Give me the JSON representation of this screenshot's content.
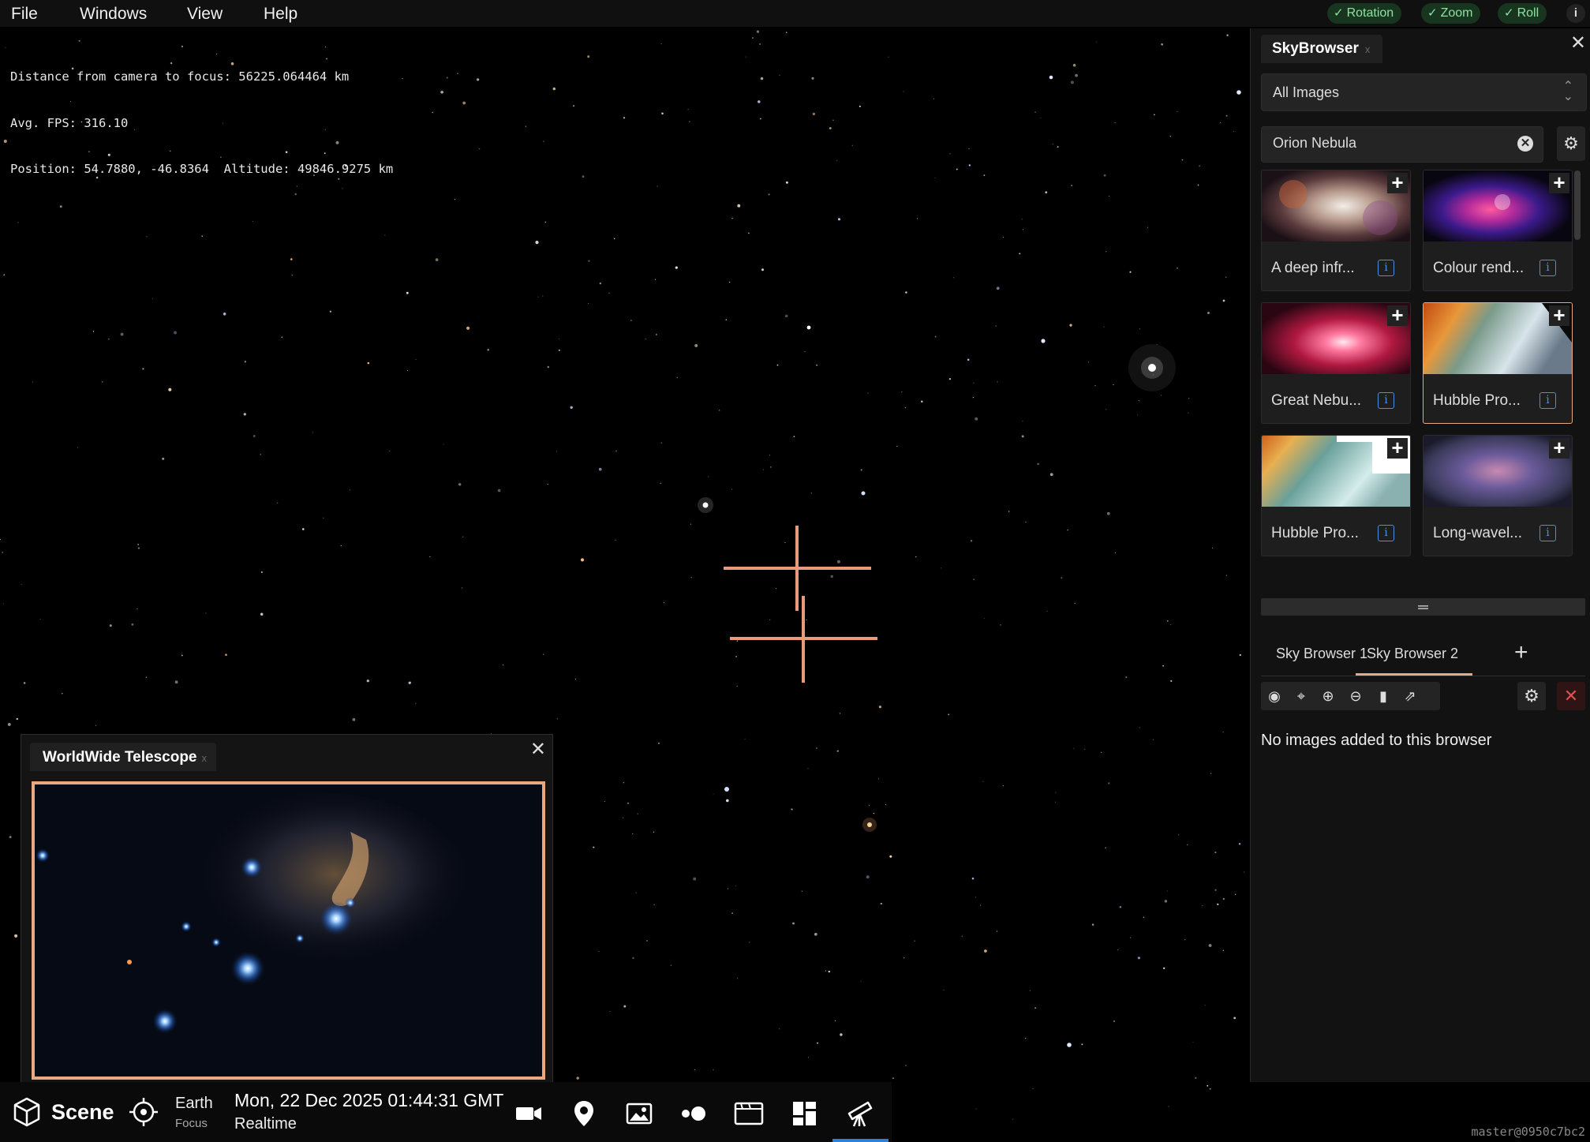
{
  "menu": {
    "items": [
      "File",
      "Windows",
      "View",
      "Help"
    ],
    "toggles": [
      {
        "label": "Rotation",
        "on": true
      },
      {
        "label": "Zoom",
        "on": true
      },
      {
        "label": "Roll",
        "on": true
      }
    ],
    "info_icon": "info-icon"
  },
  "stats": {
    "distance": "Distance from camera to focus: 56225.064464 km",
    "fps": "Avg. FPS: 316.10",
    "position": "Position: 54.7880, -46.8364  Altitude: 49846.9275 km"
  },
  "skybrowser": {
    "title": "SkyBrowser",
    "filter_value": "All Images",
    "search_value": "Orion Nebula",
    "images": [
      {
        "label": "A deep infr...",
        "selected": false
      },
      {
        "label": "Colour rend...",
        "selected": false
      },
      {
        "label": "Great Nebu...",
        "selected": false
      },
      {
        "label": "Hubble Pro...",
        "selected": true
      },
      {
        "label": "Hubble Pro...",
        "selected": false
      },
      {
        "label": "Long-wavel...",
        "selected": false
      }
    ],
    "divider_glyph": "═",
    "tabs": [
      "Sky Browser 1",
      "Sky Browser 2"
    ],
    "active_tab": "Sky Browser 2",
    "empty_message": "No images added to this browser",
    "accent_color": "#e8a882"
  },
  "wwt": {
    "title": "WorldWide Telescope"
  },
  "bottom": {
    "scene_label": "Scene",
    "focus_name": "Earth",
    "focus_sub": "Focus",
    "date": "Mon, 22 Dec 2025 01:44:31 GMT",
    "time_mode": "Realtime",
    "icons": [
      "camera-icon",
      "pin-icon",
      "image-icon",
      "exoplanets-icon",
      "window-icon",
      "dashboard-icon",
      "telescope-icon"
    ],
    "active_icon": "telescope-icon"
  },
  "version": "master@0950c7bc2"
}
